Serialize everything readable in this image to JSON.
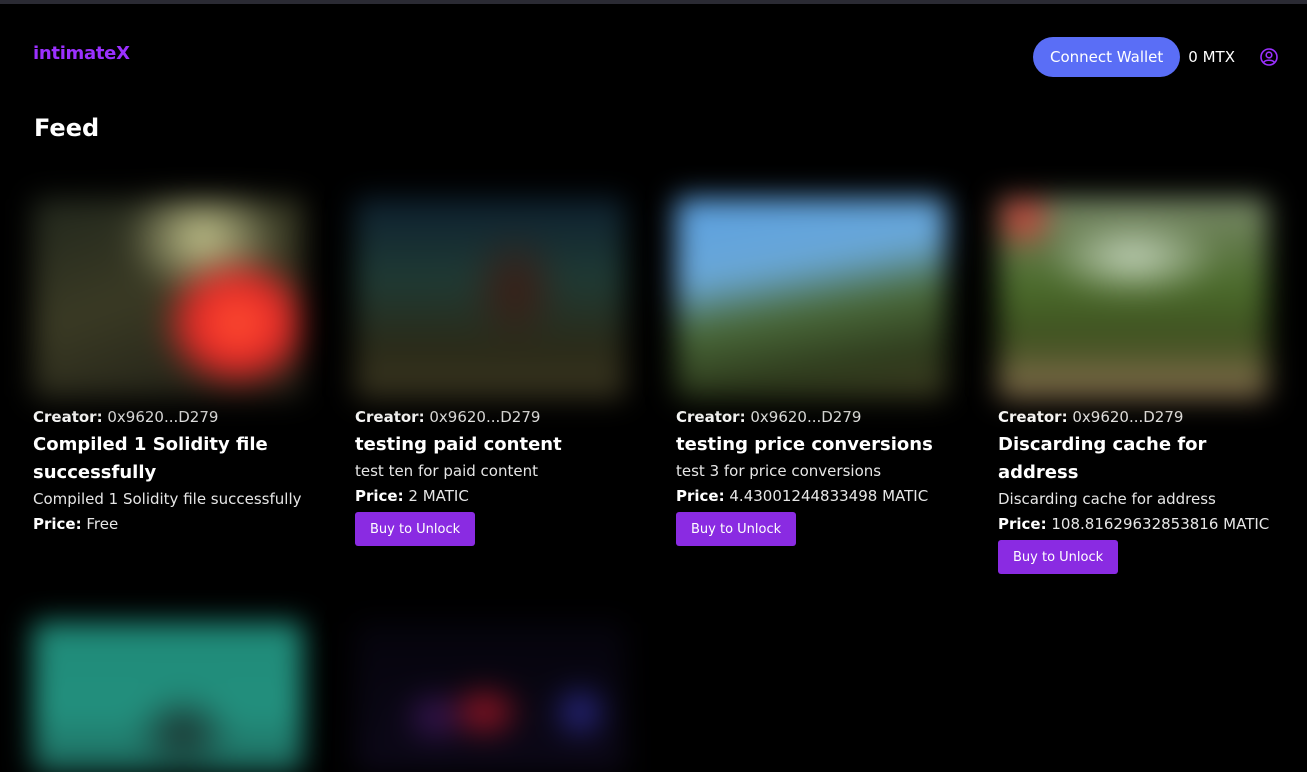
{
  "brand": "intimateX",
  "header": {
    "connect_label": "Connect Wallet",
    "balance": "0 MTX",
    "user_icon": "user-circle-icon"
  },
  "feed": {
    "title": "Feed",
    "creator_label": "Creator:",
    "price_label": "Price:",
    "buy_label": "Buy to Unlock",
    "cards": [
      {
        "creator": "0x9620...D279",
        "title": "Compiled 1 Solidity file successfully",
        "description": "Compiled 1 Solidity file successfully",
        "price": "Free",
        "locked": false
      },
      {
        "creator": "0x9620...D279",
        "title": "testing paid content",
        "description": "test ten for paid content",
        "price": "2 MATIC",
        "locked": true
      },
      {
        "creator": "0x9620...D279",
        "title": "testing price conversions",
        "description": "test 3 for price conversions",
        "price": "4.43001244833498 MATIC",
        "locked": true
      },
      {
        "creator": "0x9620...D279",
        "title": "Discarding cache for address",
        "description": "Discarding cache for address",
        "price": "108.81629632853816 MATIC",
        "locked": true
      }
    ]
  },
  "colors": {
    "accent": "#8a2be2",
    "brand": "#9b30ff",
    "connect": "#5a6ef6",
    "background": "#000000"
  }
}
